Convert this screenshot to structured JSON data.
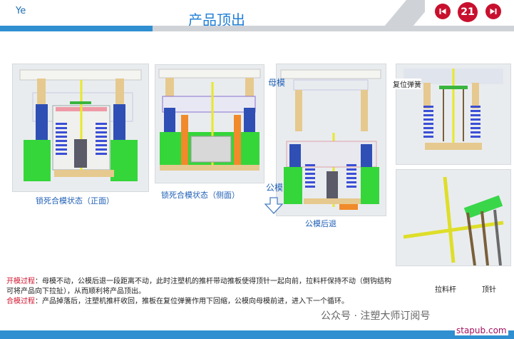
{
  "header": {
    "brand": "Ye",
    "title": "产品顶出",
    "page_number": "21",
    "prev_icon": "skip-back-icon",
    "next_icon": "skip-forward-icon"
  },
  "captions": {
    "panel1": "锁死合模状态（正面）",
    "panel2": "锁死合模状态（侧面）",
    "panel3": "公模后退",
    "mother_mold": "母模",
    "male_mold": "公模",
    "reset_spring": "复位弹簧",
    "pull_rod": "拉料杆",
    "ejector_pin": "顶针"
  },
  "description": {
    "open_label": "开模过程",
    "open_text": "：母模不动，公模后退一段距离不动，此时注塑机的推杆带动推板使得顶针一起向前，拉料杆保持不动（倒钩结构可将产品向下拉扯），从而顺利将产品顶出。",
    "close_label": "合模过程",
    "close_text": "：产品掉落后，注塑机推杆收回，推板在复位弹簧作用下回缩，公模向母模前进，进入下一个循环。"
  },
  "footer": {
    "wechat": "公众号 · 注塑大师订阅号",
    "watermark": "stapub.com"
  },
  "colors": {
    "accent_blue": "#2f8fd0",
    "title_blue": "#1f7fd6",
    "nav_red": "#c8102e",
    "highlight_red": "#d2162f"
  }
}
